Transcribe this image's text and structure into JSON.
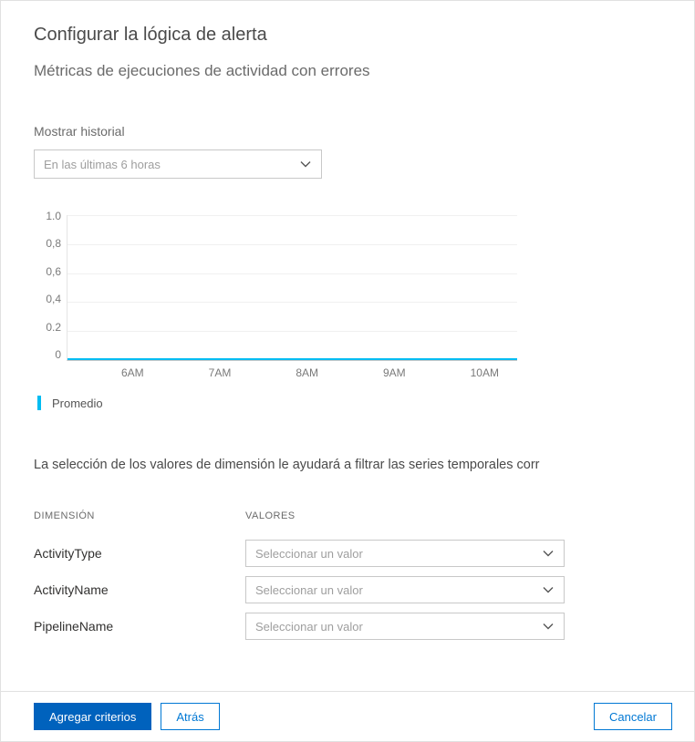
{
  "title": "Configurar la lógica de alerta",
  "subtitle": "Métricas de ejecuciones de actividad con errores",
  "history": {
    "label": "Mostrar historial",
    "selected": "En las últimas 6 horas"
  },
  "chart_data": {
    "type": "line",
    "x_ticks": [
      "6AM",
      "7AM",
      "8AM",
      "9AM",
      "10AM"
    ],
    "y_ticks": [
      "1.0",
      "0,8",
      "0,6",
      "0,4",
      "0.2",
      "0"
    ],
    "ylim": [
      0,
      1.0
    ],
    "series": [
      {
        "name": "Promedio",
        "color": "#00bcf2",
        "values": [
          0,
          0,
          0,
          0,
          0
        ]
      }
    ],
    "legend": "Promedio"
  },
  "filter_text": "La selección de los valores de dimensión le ayudará a filtrar las series temporales corr",
  "dimensions": {
    "header_name": "DIMENSIÓN",
    "header_values": "VALORES",
    "placeholder": "Seleccionar un valor",
    "rows": [
      {
        "name": "ActivityType"
      },
      {
        "name": "ActivityName"
      },
      {
        "name": "PipelineName"
      }
    ]
  },
  "footer": {
    "add": "Agregar criterios",
    "back": "Atrás",
    "cancel": "Cancelar"
  }
}
